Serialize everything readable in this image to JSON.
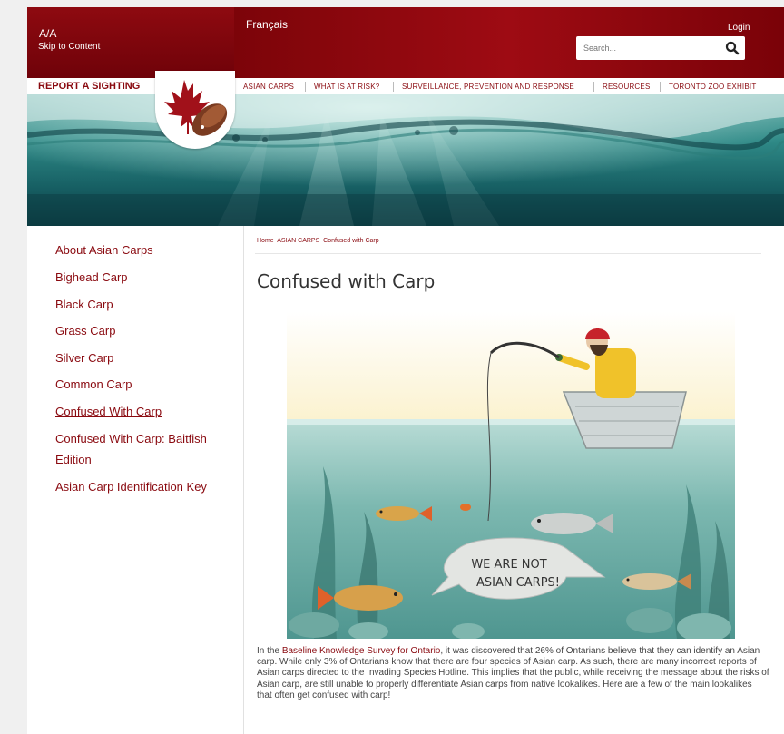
{
  "header": {
    "text_size_toggle": "A/A",
    "skip_link": "Skip to Content",
    "language_link": "Français",
    "login_link": "Login",
    "search_placeholder": "Search..."
  },
  "nav": {
    "report_sighting": "REPORT A SIGHTING",
    "items": [
      "ASIAN CARPS",
      "WHAT IS AT RISK?",
      "SURVEILLANCE, PREVENTION AND RESPONSE",
      "RESOURCES",
      "TORONTO ZOO EXHIBIT"
    ]
  },
  "sidebar": {
    "items": [
      "About Asian Carps",
      "Bighead Carp",
      "Black Carp",
      "Grass Carp",
      "Silver Carp",
      "Common Carp",
      "Confused With Carp",
      "Confused With Carp: Baitfish",
      "Edition",
      "Asian Carp Identification Key"
    ]
  },
  "breadcrumb": {
    "home": "Home",
    "section": "ASIAN CARPS",
    "current": "Confused with Carp"
  },
  "page_title": "Confused with Carp",
  "illustration": {
    "speech_line1": "WE ARE NOT",
    "speech_line2": "ASIAN CARPS!"
  },
  "body": {
    "intro_before": "In the ",
    "intro_link": "Baseline Knowledge Survey for Ontario",
    "intro_after": ", it was discovered that 26% of Ontarians believe that they can identify an Asian carp. While only 3% of Ontarians know that there are four species of Asian carp. As such, there are many incorrect reports of Asian carps directed to the Invading Species Hotline. This implies that the public, while receiving the message about the risks of Asian carp, are still unable to properly differentiate Asian carps from native lookalikes. Here are a few of the main lookalikes that often get confused with carp!"
  },
  "colors": {
    "brand_red": "#8a0a10",
    "header_red": "#7c0409"
  }
}
